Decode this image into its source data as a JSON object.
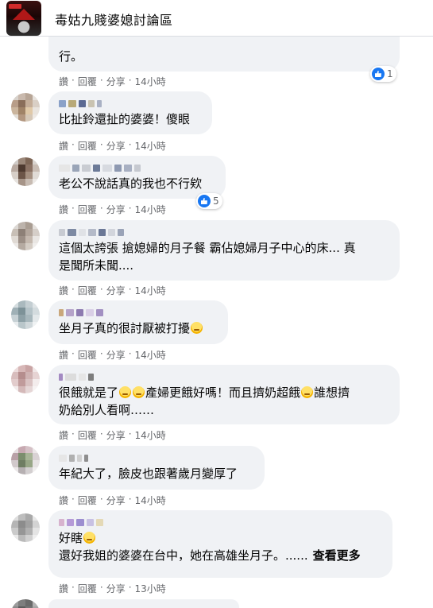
{
  "header": {
    "group_name": "毒姑九賤婆媳討論區"
  },
  "actions": {
    "like": "讚",
    "reply": "回覆",
    "share": "分享",
    "sep": "·"
  },
  "comments": [
    {
      "text": "行。",
      "time": "14小時",
      "reactions": "1"
    },
    {
      "text": "比扯鈴還扯的婆婆！傻眼",
      "time": "14小時"
    },
    {
      "text": "老公不說話真的我也不行欸",
      "time": "14小時",
      "reactions": "5"
    },
    {
      "text": "這個太誇張 搶媳婦的月子餐 霸佔媳婦月子中心的床... 真\n是聞所未聞....",
      "time": "14小時"
    },
    {
      "text": "坐月子真的很討厭被打擾",
      "time": "14小時"
    },
    {
      "text_a": "很餓就是了",
      "text_b": "產婦更餓好嗎！而且擠奶超餓",
      "text_c": "誰想擠\n奶給別人看啊……",
      "time": "14小時"
    },
    {
      "text": "年紀大了，臉皮也跟著歲月變厚了",
      "time": "14小時"
    },
    {
      "text_a": "好瞎",
      "text_b": "還好我姐的婆婆在台中，她在高雄坐月子。......",
      "see_more": "查看更多",
      "time": "13小時"
    }
  ]
}
